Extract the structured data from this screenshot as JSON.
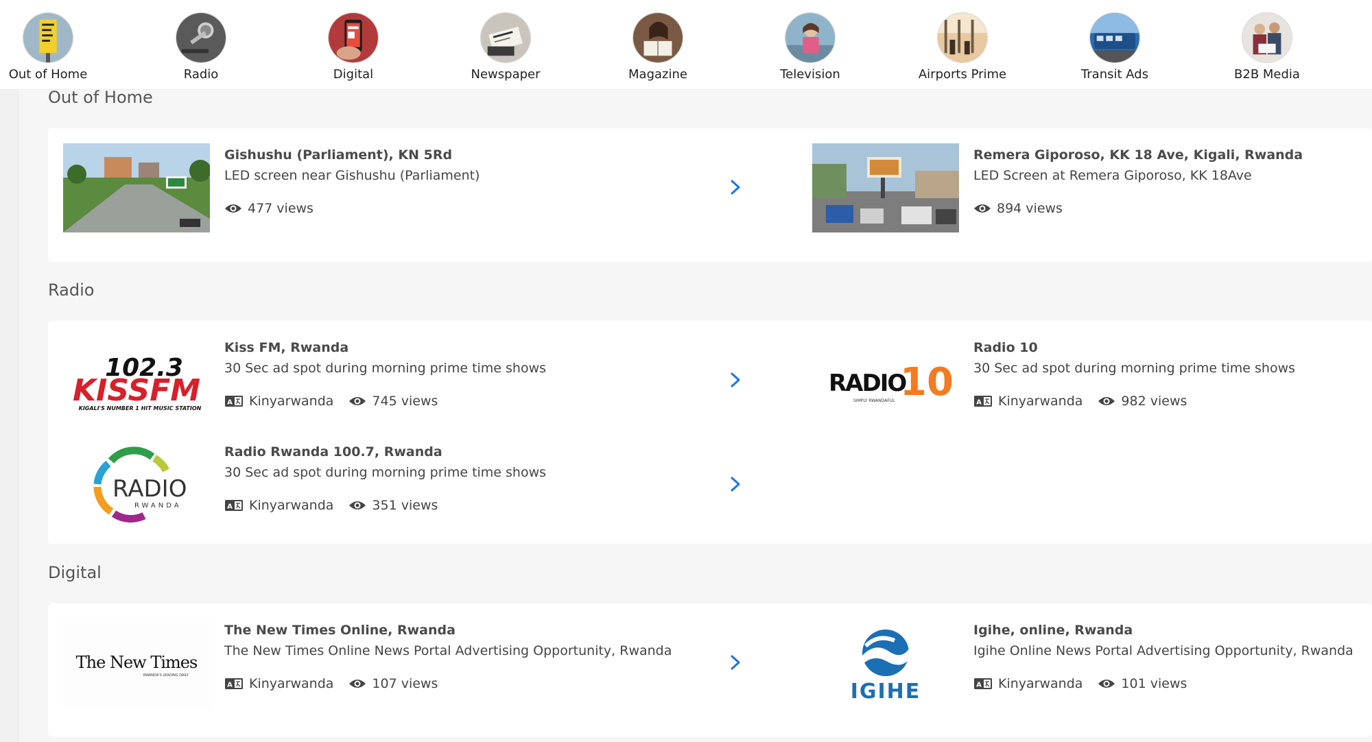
{
  "categories": [
    {
      "label": "Out of Home",
      "icon": "billboard-photo-icon"
    },
    {
      "label": "Radio",
      "icon": "microphone-photo-icon"
    },
    {
      "label": "Digital",
      "icon": "smartphone-photo-icon"
    },
    {
      "label": "Newspaper",
      "icon": "newspaper-photo-icon"
    },
    {
      "label": "Magazine",
      "icon": "magazine-photo-icon"
    },
    {
      "label": "Television",
      "icon": "tv-photo-icon"
    },
    {
      "label": "Airports Prime",
      "icon": "airport-photo-icon"
    },
    {
      "label": "Transit Ads",
      "icon": "bus-photo-icon"
    },
    {
      "label": "B2B Media",
      "icon": "b2b-photo-icon"
    }
  ],
  "sections": {
    "ooh": {
      "title": "Out of Home",
      "items": [
        {
          "title": "Gishushu (Parliament), KN 5Rd",
          "desc": "LED screen near Gishushu (Parliament)",
          "views": "477 views"
        },
        {
          "title": "Remera Giporoso, KK 18 Ave, Kigali, Rwanda",
          "desc": "LED Screen at Remera Giporoso, KK 18Ave",
          "views": "894 views"
        }
      ]
    },
    "radio": {
      "title": "Radio",
      "items": [
        {
          "title": "Kiss FM, Rwanda",
          "desc": "30 Sec ad spot during morning prime time shows",
          "language": "Kinyarwanda",
          "views": "745 views",
          "logo_text": "102.3",
          "logo_text2": "KISSFM",
          "logo_tagline": "KIGALI'S NUMBER 1 HIT MUSIC STATION"
        },
        {
          "title": "Radio 10",
          "desc": "30 Sec ad spot during morning prime time shows",
          "language": "Kinyarwanda",
          "views": "982 views",
          "logo_text": "RADIO",
          "logo_text2": "10",
          "logo_tagline": "SIMPLY RWANDAFUL"
        },
        {
          "title": "Radio Rwanda 100.7, Rwanda",
          "desc": "30 Sec ad spot during morning prime time shows",
          "language": "Kinyarwanda",
          "views": "351 views",
          "logo_text": "RADIO",
          "logo_text2": "RWANDA"
        }
      ]
    },
    "digital": {
      "title": "Digital",
      "items": [
        {
          "title": "The New Times Online, Rwanda",
          "desc": "The New Times Online News Portal Advertising Opportunity, Rwanda",
          "language": "Kinyarwanda",
          "views": "107 views",
          "logo_text": "The New Times",
          "logo_tagline": "RWANDA'S LEADING DAILY"
        },
        {
          "title": "Igihe, online, Rwanda",
          "desc": "Igihe Online News Portal Advertising Opportunity, Rwanda",
          "language": "Kinyarwanda",
          "views": "101 views",
          "logo_text": "IGIHE"
        }
      ]
    }
  },
  "colors": {
    "accent": "#1a73e8",
    "kiss_red": "#d8202a",
    "radio10_orange": "#f47b20",
    "igihe_blue": "#1b6fb5"
  }
}
